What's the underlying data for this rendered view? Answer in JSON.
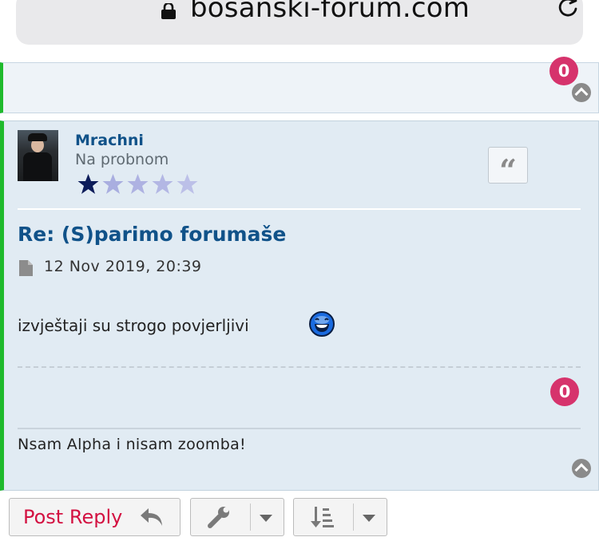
{
  "browser": {
    "url": "bosanski-forum.com",
    "lock_icon": "lock-icon",
    "reload_icon": "reload-icon"
  },
  "previous_post": {
    "reactions_count": "0"
  },
  "post": {
    "author": {
      "username": "Mrachni",
      "rank": "Na probnom",
      "rating": {
        "filled": 1,
        "total": 5
      }
    },
    "title": "Re: (S)parimo forumaše",
    "date": "12 Nov 2019, 20:39",
    "body": "izvještaji su strogo povjerljivi",
    "reactions_count": "0",
    "signature": "Nsam Alpha i nisam zoomba!"
  },
  "actions": {
    "post_reply_label": "Post Reply"
  },
  "colors": {
    "accent_link": "#105289",
    "badge": "#d6336c",
    "online_bar": "#1fba2c",
    "reply_text": "#d31141"
  }
}
